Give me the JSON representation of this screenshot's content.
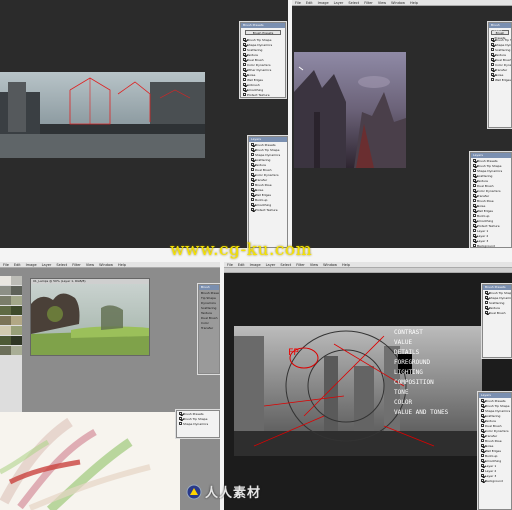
{
  "watermark": "www.cg-ku.com",
  "logo_text": "人人素材",
  "tiles": {
    "tl": {
      "brush_panel_header": "Brush Presets",
      "brush_presets_button": "Brush Presets",
      "presets": [
        "Brush Tip Shape",
        "Shape Dynamics",
        "Scattering",
        "Texture",
        "Dual Brush",
        "Color Dynamics",
        "Other Dynamics",
        "Noise",
        "Wet Edges",
        "Airbrush",
        "Smoothing",
        "Protect Texture"
      ],
      "layers_header": "Layers",
      "layers": [
        "Brush Presets",
        "Brush Tip Shape",
        "Shape Dynamics",
        "Scattering",
        "Texture",
        "Dual Brush",
        "Color Dynamics",
        "Transfer",
        "Brush Pose",
        "Noise",
        "Wet Edges",
        "Build-up",
        "Smoothing",
        "Protect Texture"
      ]
    },
    "tr": {
      "menu": [
        "File",
        "Edit",
        "Image",
        "Layer",
        "Select",
        "Filter",
        "View",
        "Window",
        "Help"
      ],
      "brush_panel_header": "Brush Presets",
      "brush_presets_button": "Brush Presets",
      "presets": [
        "Brush Tip Shape",
        "Shape Dynamics",
        "Scattering",
        "Texture",
        "Dual Brush",
        "Color Dynamics",
        "Transfer",
        "Noise",
        "Wet Edges"
      ],
      "layers_header": "Layers",
      "layers": [
        "Brush Presets",
        "Brush Tip Shape",
        "Shape Dynamics",
        "Scattering",
        "Texture",
        "Dual Brush",
        "Color Dynamics",
        "Transfer",
        "Brush Pose",
        "Noise",
        "Wet Edges",
        "Build-up",
        "Smoothing",
        "Protect Texture",
        "Layer 1",
        "Layer 2",
        "Layer 3",
        "Background"
      ]
    },
    "bl": {
      "menu": [
        "File",
        "Edit",
        "Image",
        "Layer",
        "Select",
        "Filter",
        "View",
        "Window",
        "Help"
      ],
      "doc_title": "01_Lamps @ 50% (Layer 1, RGB/8)",
      "side_header": "Brush",
      "side_rows": [
        "Brush Presets",
        "Tip Shape",
        "Dynamics",
        "Scattering",
        "Texture",
        "Dual Brush",
        "Color",
        "Transfer"
      ],
      "lower_panel_rows": [
        "Brush Presets",
        "Brush Tip Shape",
        "Shape Dynamics"
      ]
    },
    "br": {
      "menu": [
        "File",
        "Edit",
        "Image",
        "Layer",
        "Select",
        "Filter",
        "View",
        "Window",
        "Help"
      ],
      "annotation_lines": [
        "CONTRAST",
        "VALUE",
        "DETAILS",
        "FOREGROUND",
        "LIGHTING",
        "COMPOSITION",
        "TONE",
        "COLOR",
        "VALUE AND TONES"
      ],
      "focus_label": "FP",
      "panel_header": "Brush Presets",
      "panel_rows": [
        "Brush Tip Shape",
        "Shape Dynamics",
        "Scattering",
        "Texture",
        "Dual Brush"
      ],
      "layers_header": "Layers",
      "layers": [
        "Brush Presets",
        "Brush Tip Shape",
        "Shape Dynamics",
        "Scattering",
        "Texture",
        "Dual Brush",
        "Color Dynamics",
        "Transfer",
        "Brush Pose",
        "Noise",
        "Wet Edges",
        "Build-up",
        "Smoothing",
        "Layer 1",
        "Layer 2",
        "Layer 3",
        "Background"
      ]
    }
  }
}
